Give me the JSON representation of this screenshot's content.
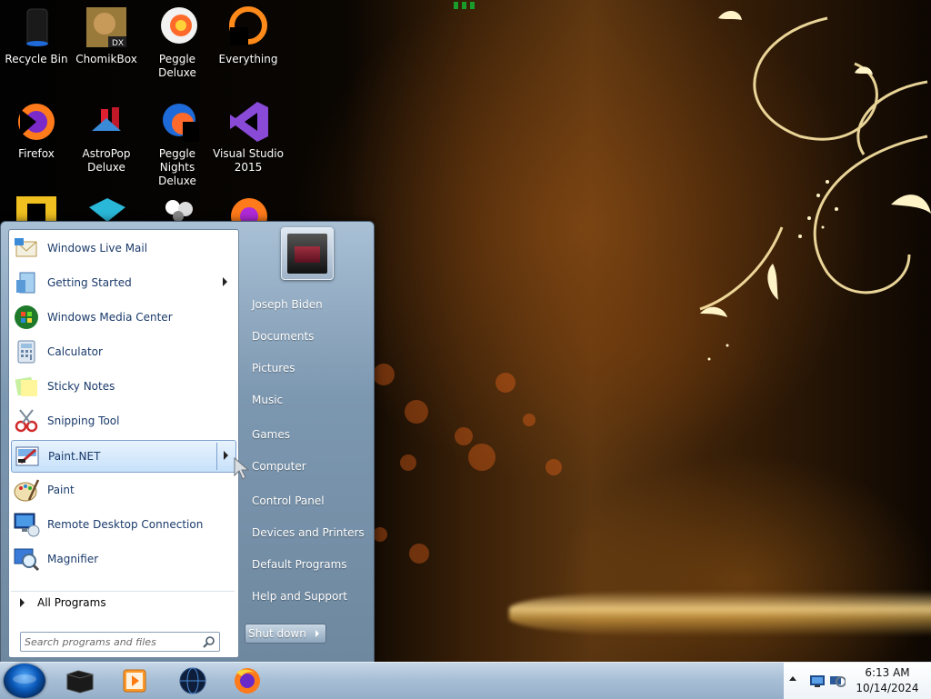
{
  "desktop": {
    "icons": [
      {
        "label": "Recycle Bin"
      },
      {
        "label": "ChomikBox"
      },
      {
        "label": "Peggle Deluxe"
      },
      {
        "label": "Everything"
      },
      {
        "label": "Firefox"
      },
      {
        "label": "AstroPop Deluxe"
      },
      {
        "label": "Peggle Nights Deluxe"
      },
      {
        "label": "Visual Studio 2015"
      }
    ]
  },
  "start_menu": {
    "programs": [
      {
        "label": "Windows Live Mail",
        "icon": "mail-icon"
      },
      {
        "label": "Getting Started",
        "icon": "getting-started-icon",
        "has_submenu": true
      },
      {
        "label": "Windows Media Center",
        "icon": "media-center-icon"
      },
      {
        "label": "Calculator",
        "icon": "calculator-icon"
      },
      {
        "label": "Sticky Notes",
        "icon": "sticky-notes-icon"
      },
      {
        "label": "Snipping Tool",
        "icon": "snipping-tool-icon"
      },
      {
        "label": "Paint.NET",
        "icon": "paint-net-icon",
        "has_submenu": true,
        "selected": true
      },
      {
        "label": "Paint",
        "icon": "paint-icon"
      },
      {
        "label": "Remote Desktop Connection",
        "icon": "remote-desktop-icon"
      },
      {
        "label": "Magnifier",
        "icon": "magnifier-icon"
      }
    ],
    "all_programs_label": "All Programs",
    "search": {
      "placeholder": "Search programs and files"
    },
    "right_links": [
      {
        "label": "Joseph Biden"
      },
      {
        "label": "Documents"
      },
      {
        "label": "Pictures"
      },
      {
        "label": "Music"
      },
      {
        "label": "Games"
      },
      {
        "label": "Computer"
      },
      {
        "label": "Control Panel"
      },
      {
        "label": "Devices and Printers"
      },
      {
        "label": "Default Programs"
      },
      {
        "label": "Help and Support"
      }
    ],
    "shutdown_label": "Shut down"
  },
  "taskbar": {
    "pinned": [
      "window-icon",
      "media-player-icon",
      "globe-icon",
      "firefox-icon"
    ],
    "clock": {
      "time": "6:13 AM",
      "date": "10/14/2024"
    }
  },
  "colors": {
    "program_text": "#1a3a6a",
    "accent": "#0a58b8"
  }
}
